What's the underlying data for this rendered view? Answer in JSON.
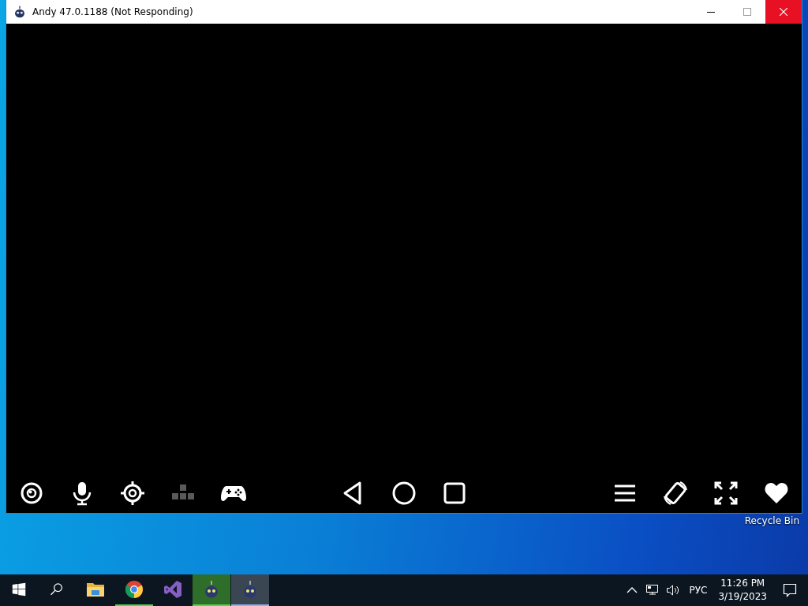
{
  "window": {
    "title": "Andy 47.0.1188 (Not Responding)",
    "controls": [
      {
        "kind": "minimize"
      },
      {
        "kind": "maximize"
      },
      {
        "kind": "close"
      }
    ]
  },
  "toolbar": {
    "left": [
      {
        "kind": "camera",
        "disabled": false
      },
      {
        "kind": "microphone",
        "disabled": false
      },
      {
        "kind": "location",
        "disabled": false
      },
      {
        "kind": "keymap",
        "disabled": true
      },
      {
        "kind": "gamepad",
        "disabled": false
      }
    ],
    "center": [
      {
        "kind": "back",
        "disabled": false
      },
      {
        "kind": "home",
        "disabled": false
      },
      {
        "kind": "recents",
        "disabled": false
      }
    ],
    "right": [
      {
        "kind": "menu",
        "disabled": false
      },
      {
        "kind": "rotate",
        "disabled": false
      },
      {
        "kind": "fullscreen",
        "disabled": false
      },
      {
        "kind": "heart",
        "disabled": false
      }
    ]
  },
  "desktop": {
    "icons": [
      {
        "label": "Recycle Bin"
      }
    ]
  },
  "taskbar": {
    "apps": [
      {
        "kind": "start",
        "running": false,
        "selected": false,
        "flashing": false
      },
      {
        "kind": "search",
        "running": false,
        "selected": false,
        "flashing": false
      },
      {
        "kind": "folder",
        "running": false,
        "selected": false,
        "flashing": false
      },
      {
        "kind": "chrome",
        "running": true,
        "selected": false,
        "flashing": false
      },
      {
        "kind": "studio",
        "running": false,
        "selected": false,
        "flashing": false
      },
      {
        "kind": "robot",
        "running": true,
        "selected": false,
        "flashing": true
      },
      {
        "kind": "robot",
        "running": true,
        "selected": true,
        "flashing": false
      }
    ],
    "tray": {
      "language": "РУС",
      "time": "11:26 PM",
      "date": "3/19/2023"
    }
  }
}
